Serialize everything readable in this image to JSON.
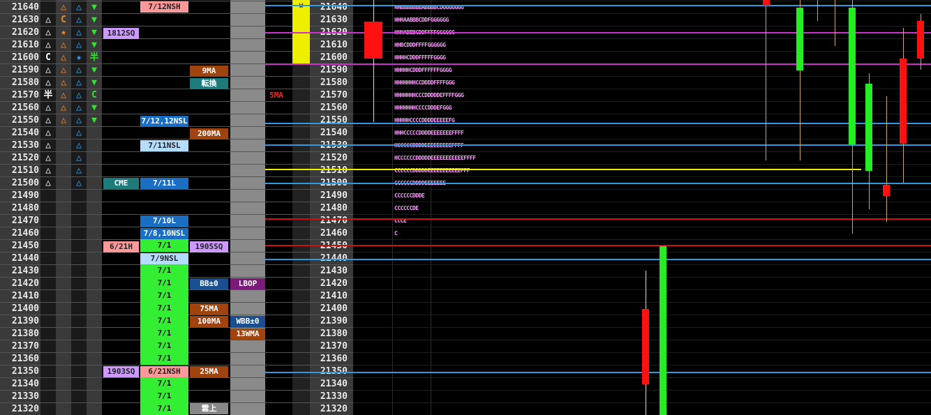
{
  "prices": [
    "21640",
    "21630",
    "21620",
    "21610",
    "21600",
    "21590",
    "21580",
    "21570",
    "21560",
    "21550",
    "21540",
    "21530",
    "21520",
    "21510",
    "21500",
    "21490",
    "21480",
    "21470",
    "21460",
    "21450",
    "21440",
    "21430",
    "21420",
    "21410",
    "21400",
    "21390",
    "21380",
    "21370",
    "21360",
    "21350",
    "21340",
    "21330",
    "21320"
  ],
  "col1": [
    "",
    "△",
    "△",
    "△",
    "C",
    "△",
    "△",
    "半",
    "△",
    "△",
    "△",
    "△",
    "△",
    "△",
    "△",
    "",
    "",
    "",
    "",
    "",
    "",
    "",
    "",
    "",
    "",
    "",
    "",
    "",
    "",
    "",
    "",
    "",
    ""
  ],
  "col2": [
    "△",
    "C",
    "★",
    "△",
    "△",
    "△",
    "△",
    "△",
    "△",
    "△",
    "",
    "",
    "",
    "",
    "",
    "",
    "",
    "",
    "",
    "",
    "",
    "",
    "",
    "",
    "",
    "",
    "",
    "",
    "",
    "",
    "",
    "",
    ""
  ],
  "col3": [
    "△",
    "△",
    "△",
    "△",
    "★",
    "△",
    "△",
    "△",
    "△",
    "△",
    "△",
    "△",
    "△",
    "△",
    "△",
    "",
    "",
    "",
    "",
    "",
    "",
    "",
    "",
    "",
    "",
    "",
    "",
    "",
    "",
    "",
    "",
    "",
    ""
  ],
  "col4": [
    "▼",
    "▼",
    "▼",
    "▼",
    "半",
    "▼",
    "▼",
    "C",
    "▼",
    "▼",
    "",
    "",
    "",
    "",
    "",
    "",
    "",
    "",
    "",
    "",
    "",
    "",
    "",
    "",
    "",
    "",
    "",
    "",
    "",
    "",
    "",
    "",
    ""
  ],
  "labels": {
    "d1812": "1812SQ",
    "cme": "CME",
    "h621": "6/21H",
    "d1903": "1903SQ",
    "nsh712": "7/12NSH",
    "nsl712": "7/12,12NSL",
    "nsl711": "7/11NSL",
    "l711": "7/11L",
    "l710": "7/10L",
    "nsl78": "7/8,10NSL",
    "d71": "7/1",
    "nsl79": "7/9NSL",
    "nsh621": "6/21NSH",
    "ma9": "9MA",
    "tenkan": "転換",
    "ma200": "200MA",
    "sq1905": "1905SQ",
    "bb": "BB±0",
    "ma75": "75MA",
    "ma100": "100MA",
    "ma25": "25MA",
    "kumo": "雲上",
    "lbop": "LBOP",
    "wbb": "WBB±0",
    "wma13": "13WMA",
    "ma5": "5MA",
    "w": "W"
  },
  "tpo_rows": [
    "HHBBBBBBBABBBBCDGGGGGGG",
    "HHHAABBBCDDFGGGGGG",
    "HHHABBBCDDFFFFGGGGGG",
    "HHBCDDDFFFFGGGGGG",
    "HHHHCDDDFFFFFGGGG",
    "HHHHHCDDDFFFFFFGGGG",
    "HHHHHHHCCDDDDFFFFGGG",
    "HHHHHHHCCCDDDDDEFFFFGGG",
    "HHHHHHHCCCCDDDEFGGG",
    "HHHHHCCCCDDDDEEEEEFG",
    "HHHCCCCCDDDDEEEEEEEFFFF",
    "HCCCCCDDDDEEEEEEEEEFFFF",
    "HCCCCCCDDDDDEEEEEEEEEEEFFFF",
    "CCCCCCDDDDDEEEEEEEEEEEFFF",
    "CCCCCCDDDDEEEEEEE",
    "CCCCCCDDDE",
    "CCCCCCDE",
    "CCCE",
    "C"
  ],
  "colors": {
    "up": "#22ee22",
    "down": "#ff1111",
    "blue_line": "#3399dd",
    "magenta_line": "#cc33cc",
    "yellow_line": "#eeee00",
    "red_line": "#cc1111"
  }
}
